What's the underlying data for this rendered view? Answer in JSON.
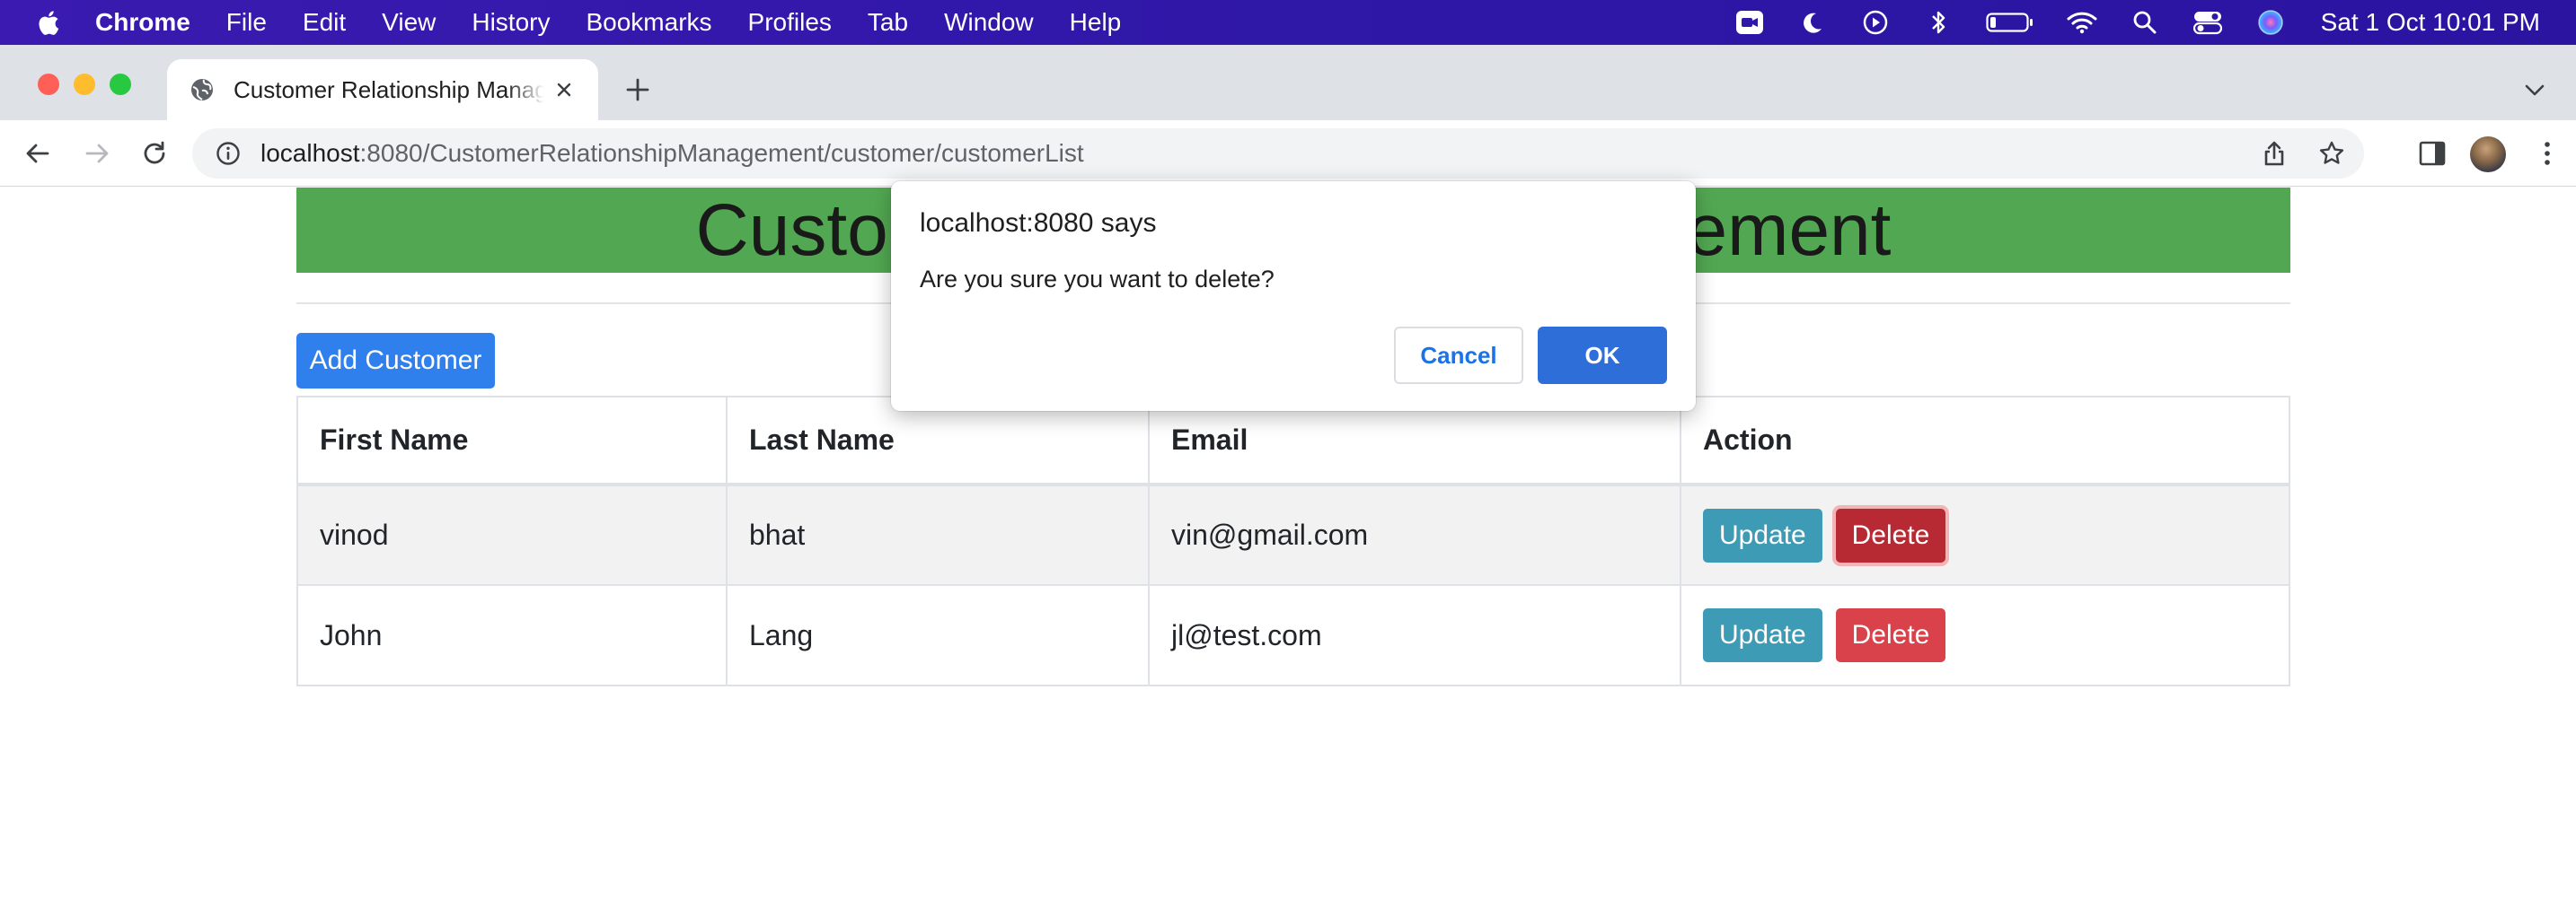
{
  "menubar": {
    "app_name": "Chrome",
    "items": [
      "File",
      "Edit",
      "View",
      "History",
      "Bookmarks",
      "Profiles",
      "Tab",
      "Window",
      "Help"
    ],
    "status_icons": [
      "facetime-icon",
      "moon-icon",
      "play-circle-icon",
      "bluetooth-icon",
      "battery-icon",
      "wifi-icon",
      "spotlight-search-icon",
      "control-center-icon",
      "siri-icon"
    ],
    "clock": "Sat 1 Oct  10:01 PM"
  },
  "browser": {
    "tab_title": "Customer Relationship Management",
    "url_host": "localhost",
    "url_rest": ":8080/CustomerRelationshipManagement/customer/customerList"
  },
  "page": {
    "heading": "Customer Relationship Management",
    "add_button": "Add Customer",
    "table": {
      "headers": [
        "First Name",
        "Last Name",
        "Email",
        "Action"
      ],
      "rows": [
        {
          "first": "vinod",
          "last": "bhat",
          "email": "vin@gmail.com",
          "update": "Update",
          "delete": "Delete"
        },
        {
          "first": "John",
          "last": "Lang",
          "email": "jl@test.com",
          "update": "Update",
          "delete": "Delete"
        }
      ]
    }
  },
  "dialog": {
    "title": "localhost:8080 says",
    "message": "Are you sure you want to delete?",
    "cancel": "Cancel",
    "ok": "OK"
  },
  "colors": {
    "menubar": "#2f17a8",
    "banner": "#52a852",
    "primary": "#2f80ed",
    "update": "#3e9bb5",
    "delete": "#d9424a",
    "dialog_ok": "#2e6ed9"
  }
}
